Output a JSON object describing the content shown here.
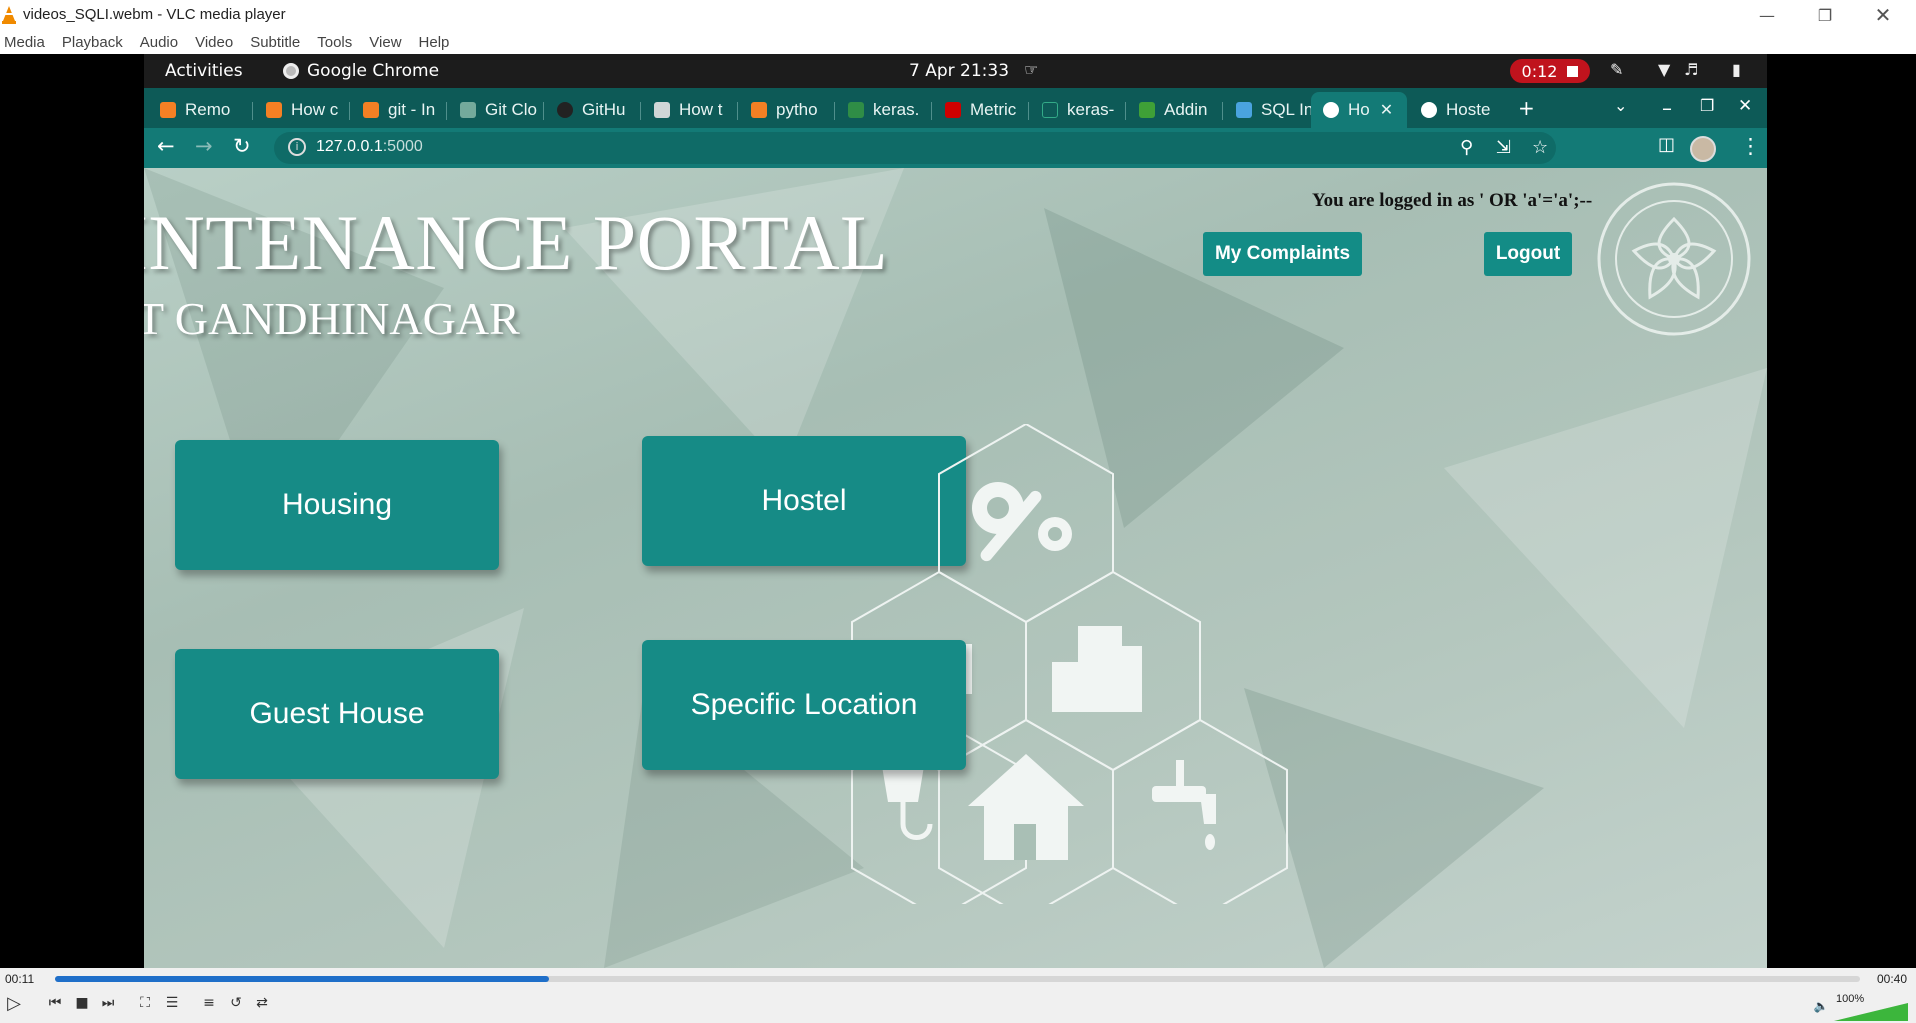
{
  "vlc": {
    "title": "videos_SQLI.webm - VLC media player",
    "menu": [
      "Media",
      "Playback",
      "Audio",
      "Video",
      "Subtitle",
      "Tools",
      "View",
      "Help"
    ],
    "elapsed": "00:11",
    "total": "00:40",
    "progress": 0.2735,
    "volume": "100%"
  },
  "gnome": {
    "activities": "Activities",
    "app": "Google Chrome",
    "clock": "7 Apr  21:33",
    "recording": "0:12"
  },
  "chrome": {
    "tabs": [
      {
        "label": "Remo",
        "color": "#f48024"
      },
      {
        "label": "How c",
        "color": "#f48024"
      },
      {
        "label": "git - In",
        "color": "#f48024"
      },
      {
        "label": "Git Clo",
        "color": "#74aa9c"
      },
      {
        "label": "GitHu",
        "color": "#222222"
      },
      {
        "label": "How t",
        "color": "#d0d6d6"
      },
      {
        "label": "pytho",
        "color": "#f48024"
      },
      {
        "label": "keras.",
        "color": "#2f8d46"
      },
      {
        "label": "Metric",
        "color": "#d00000"
      },
      {
        "label": "keras-",
        "color": "#0d5a57"
      },
      {
        "label": "Addin",
        "color": "#3fa037"
      },
      {
        "label": "SQL In",
        "color": "#4aa3df"
      },
      {
        "label": "Ho",
        "color": "#ffffff"
      },
      {
        "label": "Hoste",
        "color": "#ffffff"
      }
    ],
    "url_host": "127.0.0.1",
    "url_port": ":5000"
  },
  "page": {
    "title": "INTENANCE PORTAL",
    "subtitle": "T GANDHINAGAR",
    "login_text": "You are logged in as ' OR 'a'='a';--",
    "my_complaints": "My Complaints",
    "logout": "Logout",
    "cards": {
      "housing": "Housing",
      "hostel": "Hostel",
      "guest_house": "Guest House",
      "specific_location": "Specific Location"
    }
  },
  "colors": {
    "accent": "#168b86",
    "chrome_dark": "#0d5a57",
    "chrome_toolbar": "#137a76",
    "record": "#c0131d",
    "seek": "#1f6fc9"
  }
}
